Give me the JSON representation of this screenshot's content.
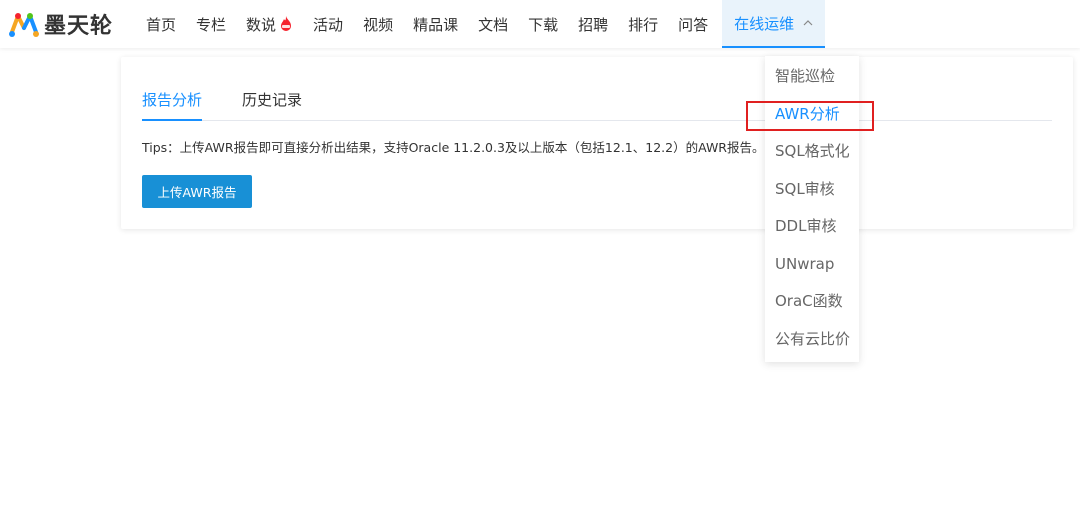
{
  "header": {
    "logo_text": "墨天轮",
    "nav_items": [
      "首页",
      "专栏",
      "数说",
      "活动",
      "视频",
      "精品课",
      "文档",
      "下载",
      "招聘",
      "排行",
      "问答"
    ],
    "active_nav": "在线运维"
  },
  "dropdown": {
    "items": [
      "智能巡检",
      "AWR分析",
      "SQL格式化",
      "SQL审核",
      "DDL审核",
      "UNwrap",
      "OraC函数",
      "公有云比价"
    ],
    "highlighted": "AWR分析"
  },
  "main": {
    "tabs": [
      "报告分析",
      "历史记录"
    ],
    "active_tab": "报告分析",
    "tips": "Tips：上传AWR报告即可直接分析出结果，支持Oracle 11.2.0.3及以上版本（包括12.1、12.2）的AWR报告。",
    "upload_label": "上传AWR报告"
  },
  "colors": {
    "accent": "#1890ff",
    "button": "#1890d6",
    "highlight_box": "#e02020",
    "hot_badge": "#f5222d"
  }
}
